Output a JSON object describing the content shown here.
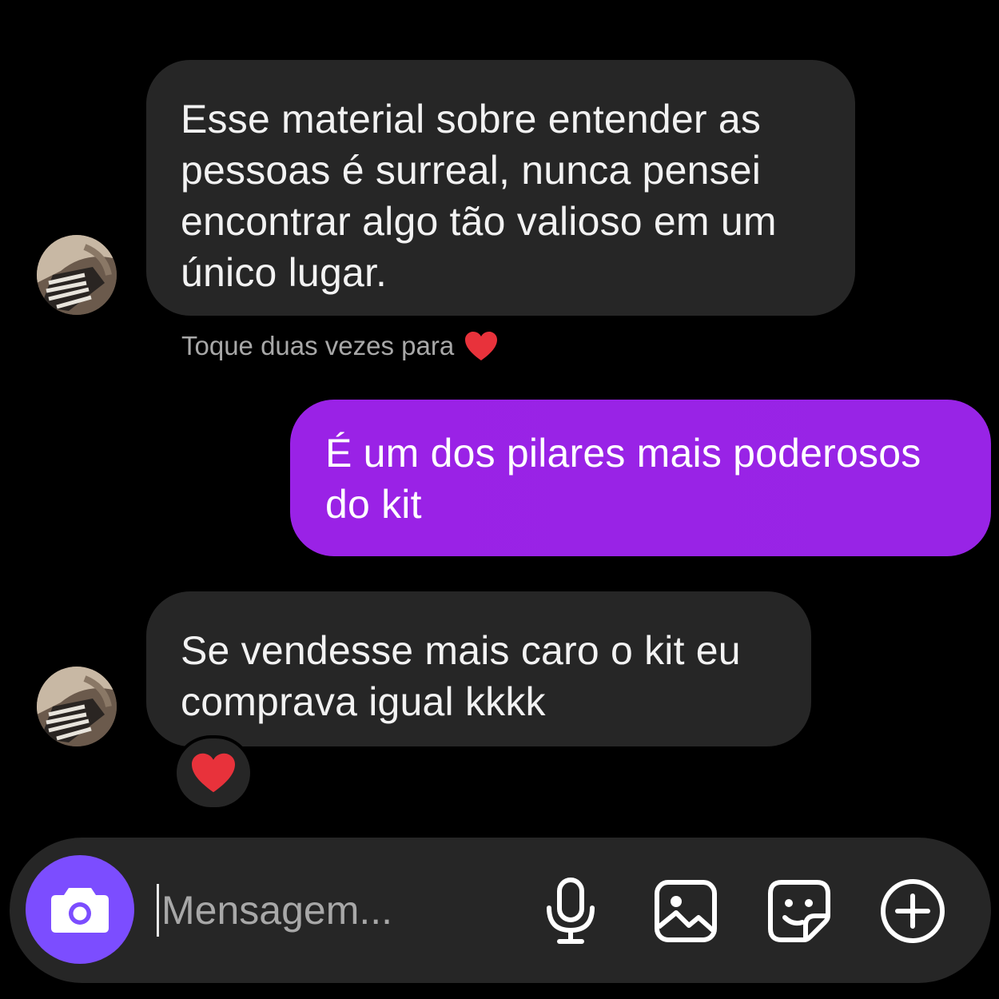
{
  "thread": {
    "messages": [
      {
        "sender": "them",
        "lines": [
          "Esse material sobre entender as",
          "pessoas é surreal, nunca pensei",
          "encontrar algo tão valioso em um",
          "único lugar."
        ]
      },
      {
        "sender": "me",
        "lines": [
          "É um dos pilares mais poderosos",
          "do kit"
        ]
      },
      {
        "sender": "them",
        "lines": [
          "Se vendesse mais caro o kit eu",
          "comprava igual kkkk"
        ],
        "reaction": "heart"
      }
    ],
    "like_hint": "Toque duas vezes para"
  },
  "composer": {
    "placeholder": "Mensagem...",
    "value": "",
    "icons": [
      "camera-icon",
      "microphone-icon",
      "gallery-icon",
      "sticker-icon",
      "add-circle-icon"
    ]
  },
  "colors": {
    "background": "#000000",
    "incoming_bubble": "#262626",
    "outgoing_bubble": "#9a22e6",
    "camera_button": "#7c4dff",
    "heart": "#e8323b",
    "hint_text": "#a8a8a8"
  }
}
